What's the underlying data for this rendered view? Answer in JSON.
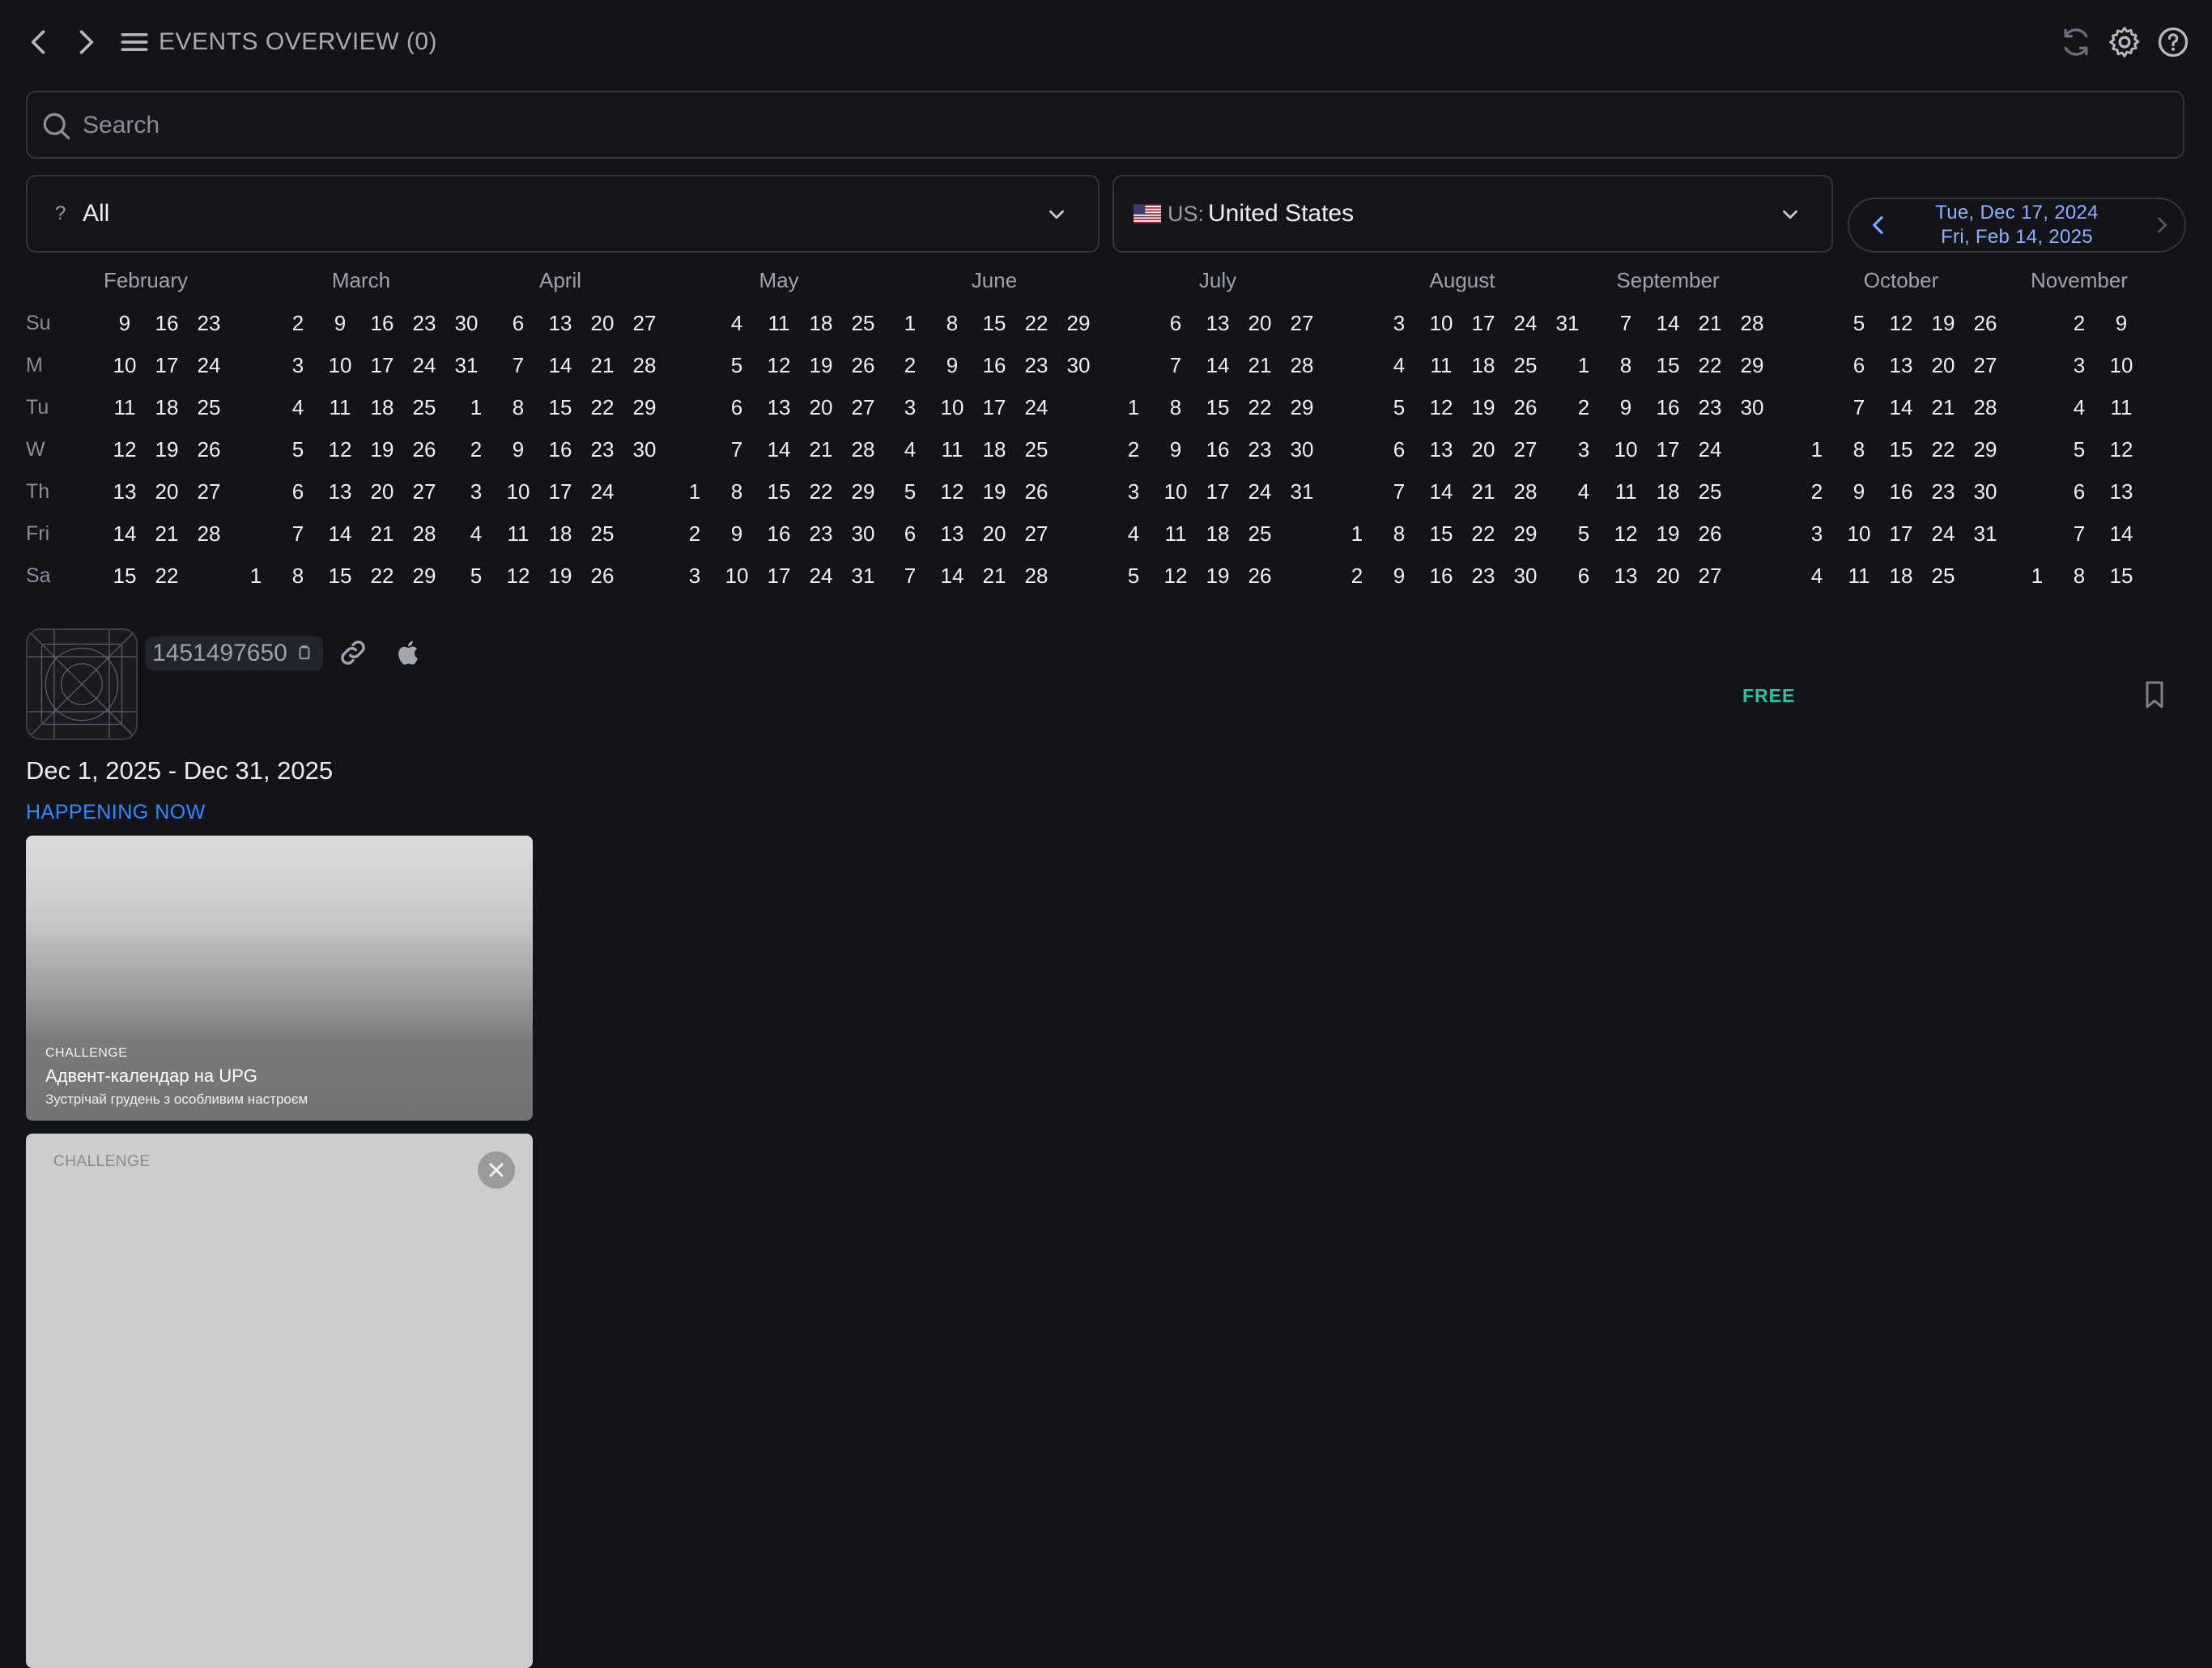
{
  "header": {
    "title": "EVENTS OVERVIEW",
    "count": "(0)",
    "icons": [
      "chevron-left-icon",
      "chevron-right-icon",
      "menu-icon",
      "refresh-icon",
      "gear-icon",
      "help-icon"
    ]
  },
  "search": {
    "placeholder": "Search",
    "value": ""
  },
  "filters": {
    "type": {
      "prefix": "?",
      "value": "All"
    },
    "country": {
      "code": "US:",
      "value": "United States",
      "flag": "us-flag"
    }
  },
  "date_range": {
    "start": "Tue, Dec 17, 2024",
    "end": "Fri, Feb 14, 2025"
  },
  "calendar": {
    "weekdays": [
      "Su",
      "M",
      "Tu",
      "W",
      "Th",
      "Fri",
      "Sa"
    ],
    "months": [
      {
        "name": "February",
        "columns": [
          [
            null,
            null,
            null,
            null,
            null,
            null,
            null
          ],
          [
            9,
            10,
            11,
            12,
            13,
            14,
            15
          ],
          [
            16,
            17,
            18,
            19,
            20,
            21,
            22
          ],
          [
            23,
            24,
            25,
            26,
            27,
            28,
            null
          ]
        ]
      },
      {
        "name": "March",
        "columns": [
          [
            null,
            null,
            null,
            null,
            null,
            null,
            1
          ],
          [
            2,
            3,
            4,
            5,
            6,
            7,
            8
          ],
          [
            9,
            10,
            11,
            12,
            13,
            14,
            15
          ],
          [
            16,
            17,
            18,
            19,
            20,
            21,
            22
          ],
          [
            23,
            24,
            25,
            26,
            27,
            28,
            29
          ],
          [
            30,
            31,
            null,
            null,
            null,
            null,
            null
          ]
        ]
      },
      {
        "name": "April",
        "columns": [
          [
            null,
            null,
            1,
            2,
            3,
            4,
            5
          ],
          [
            6,
            7,
            8,
            9,
            10,
            11,
            12
          ],
          [
            13,
            14,
            15,
            16,
            17,
            18,
            19
          ],
          [
            20,
            21,
            22,
            23,
            24,
            25,
            26
          ],
          [
            27,
            28,
            29,
            30,
            null,
            null,
            null
          ]
        ]
      },
      {
        "name": "May",
        "columns": [
          [
            null,
            null,
            null,
            null,
            1,
            2,
            3
          ],
          [
            4,
            5,
            6,
            7,
            8,
            9,
            10
          ],
          [
            11,
            12,
            13,
            14,
            15,
            16,
            17
          ],
          [
            18,
            19,
            20,
            21,
            22,
            23,
            24
          ],
          [
            25,
            26,
            27,
            28,
            29,
            30,
            31
          ]
        ]
      },
      {
        "name": "June",
        "columns": [
          [
            1,
            2,
            3,
            4,
            5,
            6,
            7
          ],
          [
            8,
            9,
            10,
            11,
            12,
            13,
            14
          ],
          [
            15,
            16,
            17,
            18,
            19,
            20,
            21
          ],
          [
            22,
            23,
            24,
            25,
            26,
            27,
            28
          ],
          [
            29,
            30,
            null,
            null,
            null,
            null,
            null
          ]
        ]
      },
      {
        "name": "July",
        "columns": [
          [
            null,
            null,
            1,
            2,
            3,
            4,
            5
          ],
          [
            6,
            7,
            8,
            9,
            10,
            11,
            12
          ],
          [
            13,
            14,
            15,
            16,
            17,
            18,
            19
          ],
          [
            20,
            21,
            22,
            23,
            24,
            25,
            26
          ],
          [
            27,
            28,
            29,
            30,
            31,
            null,
            null
          ]
        ]
      },
      {
        "name": "August",
        "columns": [
          [
            null,
            null,
            null,
            null,
            null,
            1,
            2
          ],
          [
            3,
            4,
            5,
            6,
            7,
            8,
            9
          ],
          [
            10,
            11,
            12,
            13,
            14,
            15,
            16
          ],
          [
            17,
            18,
            19,
            20,
            21,
            22,
            23
          ],
          [
            24,
            25,
            26,
            27,
            28,
            29,
            30
          ],
          [
            31,
            null,
            null,
            null,
            null,
            null,
            null
          ]
        ]
      },
      {
        "name": "September",
        "columns": [
          [
            null,
            1,
            2,
            3,
            4,
            5,
            6
          ],
          [
            7,
            8,
            9,
            10,
            11,
            12,
            13
          ],
          [
            14,
            15,
            16,
            17,
            18,
            19,
            20
          ],
          [
            21,
            22,
            23,
            24,
            25,
            26,
            27
          ],
          [
            28,
            29,
            30,
            null,
            null,
            null,
            null
          ]
        ]
      },
      {
        "name": "October",
        "columns": [
          [
            null,
            null,
            null,
            1,
            2,
            3,
            4
          ],
          [
            5,
            6,
            7,
            8,
            9,
            10,
            11
          ],
          [
            12,
            13,
            14,
            15,
            16,
            17,
            18
          ],
          [
            19,
            20,
            21,
            22,
            23,
            24,
            25
          ],
          [
            26,
            27,
            28,
            29,
            30,
            31,
            null
          ]
        ]
      },
      {
        "name": "November",
        "columns": [
          [
            null,
            null,
            null,
            null,
            null,
            null,
            1
          ],
          [
            2,
            3,
            4,
            5,
            6,
            7,
            8
          ],
          [
            9,
            10,
            11,
            12,
            13,
            14,
            15
          ]
        ]
      }
    ]
  },
  "app": {
    "id": "1451497650",
    "price": "FREE",
    "date_range": "Dec 1, 2025 - Dec 31, 2025",
    "status": "HAPPENING NOW",
    "status_color": "#2f8cff",
    "price_color": "#27c7a5"
  },
  "cards": [
    {
      "tag": "CHALLENGE",
      "title": "Адвент-календар на UPG",
      "subtitle": "Зустрічай грудень з особливим настроєм"
    },
    {
      "tag": "CHALLENGE"
    }
  ]
}
